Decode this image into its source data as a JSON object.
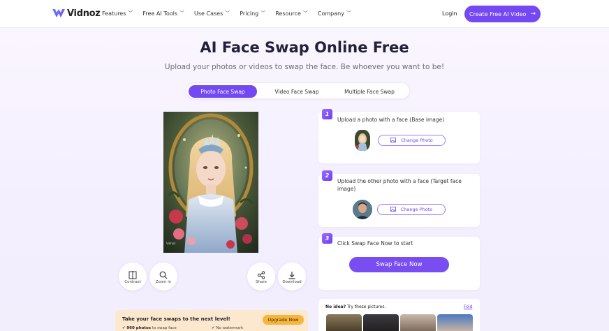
{
  "header": {
    "brand": "Vidnoz",
    "nav": [
      {
        "label": "Features",
        "name": "nav-features"
      },
      {
        "label": "Free AI Tools",
        "name": "nav-free-ai-tools"
      },
      {
        "label": "Use Cases",
        "name": "nav-use-cases"
      },
      {
        "label": "Pricing",
        "name": "nav-pricing"
      },
      {
        "label": "Resource",
        "name": "nav-resource"
      },
      {
        "label": "Company",
        "name": "nav-company"
      }
    ],
    "login": "Login",
    "cta": "Create Free AI Video",
    "cta_arrow": "→"
  },
  "hero": {
    "title": "AI Face Swap Online Free",
    "subtitle": "Upload your photos or videos to swap the face. Be whoever you want to be!"
  },
  "tabs": [
    {
      "label": "Photo Face Swap",
      "active": true
    },
    {
      "label": "Video Face Swap",
      "active": false
    },
    {
      "label": "Multiple Face Swap",
      "active": false
    }
  ],
  "preview": {
    "watermark": "Vidnoz"
  },
  "tools": {
    "contrast": "Contrast",
    "zoom": "Zoom in",
    "share": "Share",
    "download": "Download"
  },
  "steps": [
    {
      "number": "1",
      "text": "Upload a photo with a face (Base image)",
      "button": "Change Photo"
    },
    {
      "number": "2",
      "text": "Upload the other photo with a face (Target face image)",
      "button": "Change Photo"
    },
    {
      "number": "3",
      "text": "Click Swap Face Now to start",
      "button": "Swap Face Now"
    }
  ],
  "upgrade": {
    "title": "Take your face swaps to the next level!",
    "button": "Upgrade Now",
    "feature1_bold": "960 photos",
    "feature1_rest": " to swap face",
    "feature2": "No watermark"
  },
  "suggestions": {
    "title_bold": "No idea?",
    "title_rest": "  Try these pictures.",
    "fold": "Fold"
  },
  "colors": {
    "accent": "#7448f2",
    "upgrade_bg": "#fbe8cf",
    "upgrade_button": "#f7b53c"
  }
}
